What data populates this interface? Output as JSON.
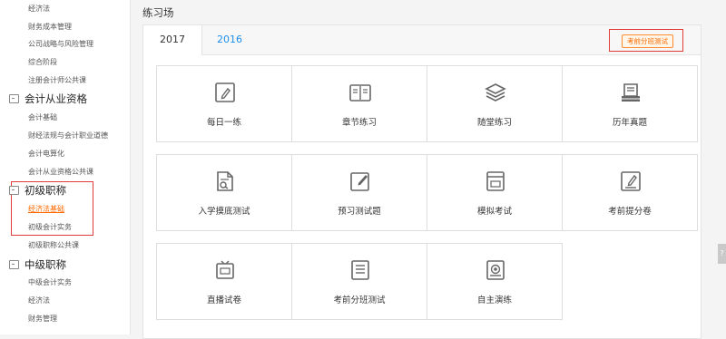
{
  "sidebar": {
    "items": [
      {
        "type": "sub",
        "label": "经济法"
      },
      {
        "type": "sub",
        "label": "财务成本管理"
      },
      {
        "type": "sub",
        "label": "公司战略与风险管理"
      },
      {
        "type": "sub",
        "label": "综合阶段"
      },
      {
        "type": "sub",
        "label": "注册会计师公共课"
      },
      {
        "type": "head",
        "label": "会计从业资格"
      },
      {
        "type": "sub",
        "label": "会计基础"
      },
      {
        "type": "sub",
        "label": "财经法规与会计职业道德"
      },
      {
        "type": "sub",
        "label": "会计电算化"
      },
      {
        "type": "sub",
        "label": "会计从业资格公共课"
      },
      {
        "type": "head",
        "label": "初级职称"
      },
      {
        "type": "sub",
        "label": "经济法基础",
        "active": true
      },
      {
        "type": "sub",
        "label": "初级会计实务"
      },
      {
        "type": "sub",
        "label": "初级职称公共课"
      },
      {
        "type": "head",
        "label": "中级职称"
      },
      {
        "type": "sub",
        "label": "中级会计实务"
      },
      {
        "type": "sub",
        "label": "经济法"
      },
      {
        "type": "sub",
        "label": "财务管理"
      }
    ]
  },
  "main": {
    "title": "练习场",
    "tabs": [
      {
        "label": "2017",
        "active": true
      },
      {
        "label": "2016",
        "active": false
      }
    ],
    "test_button": "考前分班测试",
    "cards": [
      {
        "label": "每日一练",
        "icon": "pencil-square-icon"
      },
      {
        "label": "章节练习",
        "icon": "open-book-icon"
      },
      {
        "label": "随堂练习",
        "icon": "layers-icon"
      },
      {
        "label": "历年真题",
        "icon": "paper-stack-icon"
      },
      {
        "label": "入学摸底测试",
        "icon": "document-magnifier-icon"
      },
      {
        "label": "预习测试题",
        "icon": "edit-note-icon"
      },
      {
        "label": "模拟考试",
        "icon": "exam-window-icon"
      },
      {
        "label": "考前提分卷",
        "icon": "pen-doc-icon"
      },
      {
        "label": "直播试卷",
        "icon": "tv-icon"
      },
      {
        "label": "考前分班测试",
        "icon": "list-doc-icon"
      },
      {
        "label": "自主演练",
        "icon": "target-icon"
      }
    ]
  },
  "colors": {
    "accent_orange": "#ff6a00",
    "link_blue": "#1e8ee8",
    "highlight_red": "#e23b3b",
    "icon_gray": "#666666"
  },
  "edge_tab": "?"
}
